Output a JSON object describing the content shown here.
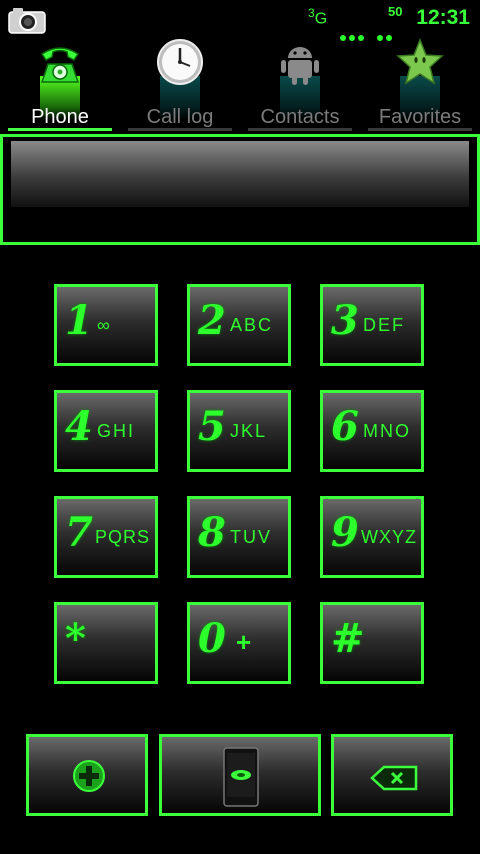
{
  "status_bar": {
    "network": "3G",
    "signal_level": "50",
    "time": "12:31",
    "icons": [
      "camera-icon",
      "signal-dots-icon"
    ]
  },
  "tabs": [
    {
      "label": "Phone",
      "icon": "phone-icon",
      "active": true
    },
    {
      "label": "Call log",
      "icon": "clock-icon",
      "active": false
    },
    {
      "label": "Contacts",
      "icon": "android-icon",
      "active": false
    },
    {
      "label": "Favorites",
      "icon": "star-icon",
      "active": false
    }
  ],
  "dial_field": {
    "value": ""
  },
  "keypad": [
    {
      "digit": "1",
      "letters": "∞"
    },
    {
      "digit": "2",
      "letters": "ABC"
    },
    {
      "digit": "3",
      "letters": "DEF"
    },
    {
      "digit": "4",
      "letters": "GHI"
    },
    {
      "digit": "5",
      "letters": "JKL"
    },
    {
      "digit": "6",
      "letters": "MNO"
    },
    {
      "digit": "7",
      "letters": "PQRS"
    },
    {
      "digit": "8",
      "letters": "TUV"
    },
    {
      "digit": "9",
      "letters": "WXYZ"
    },
    {
      "digit": "*",
      "letters": ""
    },
    {
      "digit": "0",
      "letters": "+"
    },
    {
      "digit": "#",
      "letters": ""
    }
  ],
  "bottom_buttons": [
    "add-contact-button",
    "call-button",
    "delete-button"
  ],
  "colors": {
    "accent": "#3cff3c",
    "background": "#000000",
    "inactive_label": "#7b7b7b"
  }
}
